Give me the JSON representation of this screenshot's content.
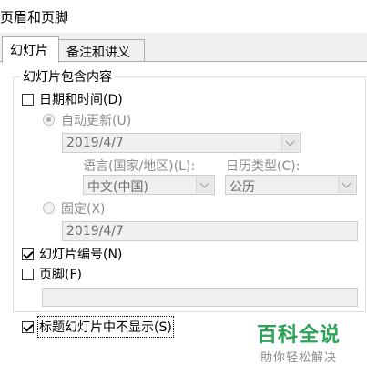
{
  "window": {
    "title": "页眉和页脚"
  },
  "tabs": [
    {
      "label": "幻灯片",
      "active": true
    },
    {
      "label": "备注和讲义",
      "active": false
    }
  ],
  "group": {
    "label": "幻灯片包含内容"
  },
  "date_time": {
    "label": "日期和时间(D)",
    "checked": false,
    "auto_update": {
      "label": "自动更新(U)",
      "selected": true,
      "value": "2019/4/7"
    },
    "language": {
      "label": "语言(国家/地区)(L):",
      "value": "中文(中国)"
    },
    "calendar": {
      "label": "日历类型(C):",
      "value": "公历"
    },
    "fixed": {
      "label": "固定(X)",
      "selected": false,
      "value": "2019/4/7"
    }
  },
  "slide_number": {
    "label": "幻灯片编号(N)",
    "checked": true
  },
  "footer": {
    "label": "页脚(F)",
    "checked": false,
    "value": ""
  },
  "hide_on_title": {
    "label": "标题幻灯片中不显示(S)",
    "checked": true
  },
  "watermark": {
    "title": "百科全说",
    "subtitle": "助你轻松解决"
  }
}
